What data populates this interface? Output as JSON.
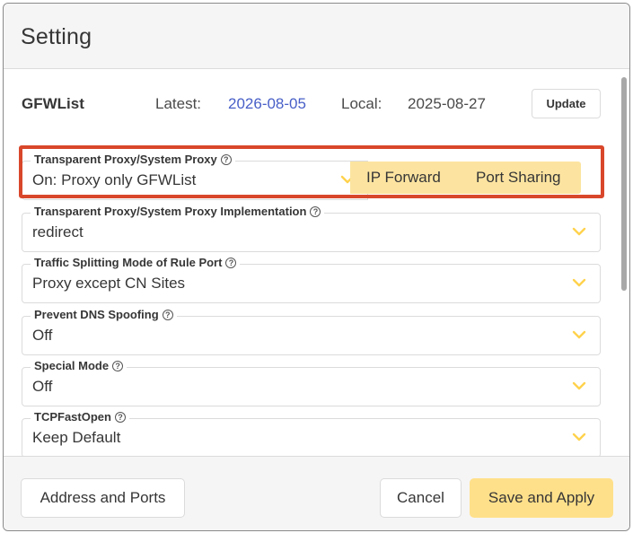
{
  "dialog": {
    "title": "Setting"
  },
  "gfwlist": {
    "title": "GFWList",
    "latest_label": "Latest:",
    "latest_value": "2026-08-05",
    "local_label": "Local:",
    "local_value": "2025-08-27",
    "update_label": "Update"
  },
  "fields": [
    {
      "label": "Transparent Proxy/System Proxy",
      "value": "On: Proxy only GFWList"
    },
    {
      "label": "Transparent Proxy/System Proxy Implementation",
      "value": "redirect"
    },
    {
      "label": "Traffic Splitting Mode of Rule Port",
      "value": "Proxy except CN Sites"
    },
    {
      "label": "Prevent DNS Spoofing",
      "value": "Off"
    },
    {
      "label": "Special Mode",
      "value": "Off"
    },
    {
      "label": "TCPFastOpen",
      "value": "Keep Default"
    }
  ],
  "toggles": {
    "ip_forward": "IP Forward",
    "port_sharing": "Port Sharing"
  },
  "footer": {
    "address_ports": "Address and Ports",
    "cancel": "Cancel",
    "save_apply": "Save and Apply"
  },
  "colors": {
    "accent_yellow": "#ffe08a",
    "date_link": "#485fc7",
    "highlight_border": "#d9472b",
    "chevron": "#ffd24d"
  },
  "icons": {
    "help": "question-circle-icon",
    "select": "chevron-down-icon"
  }
}
